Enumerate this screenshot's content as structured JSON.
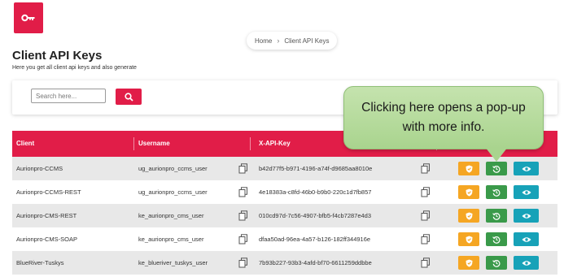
{
  "app": {
    "logo_icon": "key-icon",
    "brand_color": "#e11d48"
  },
  "breadcrumb": {
    "home": "Home",
    "separator": "›",
    "current": "Client API Keys"
  },
  "page": {
    "title": "Client API Keys",
    "subtitle": "Here you get all client api keys and also generate"
  },
  "search": {
    "placeholder": "Search here...",
    "value": ""
  },
  "table": {
    "headers": {
      "client": "Client",
      "username": "Username",
      "api_key": "X-API-Key"
    },
    "rows": [
      {
        "client": "Aurionpro-CCMS",
        "username": "ug_aurionpro_ccms_user",
        "api_key": "b42d77f5-b971-4196-a74f-d9685aa8010e"
      },
      {
        "client": "Aurionpro-CCMS-REST",
        "username": "ug_aurionpro_ccms_user",
        "api_key": "4e18383a-c8fd-46b0-b9b0-220c1d7fb857"
      },
      {
        "client": "Aurionpro-CMS-REST",
        "username": "ke_aurionpro_cms_user",
        "api_key": "010cd97d-7c56-4907-bfb5-f4cb7287e4d3"
      },
      {
        "client": "Aurionpro-CMS-SOAP",
        "username": "ke_aurionpro_cms_user",
        "api_key": "dfaa50ad-96ea-4a57-b126-182ff344916e"
      },
      {
        "client": "BlueRiver-Tuskys",
        "username": "ke_blueriver_tuskys_user",
        "api_key": "7b93b227-93b3-4afd-bf70-6611259ddbbe"
      }
    ]
  },
  "action_colors": {
    "shield": "#f5a623",
    "history": "#3a9a4a",
    "view": "#17a2b8"
  },
  "callout": {
    "text": "Clicking here opens a pop-up with more info."
  }
}
